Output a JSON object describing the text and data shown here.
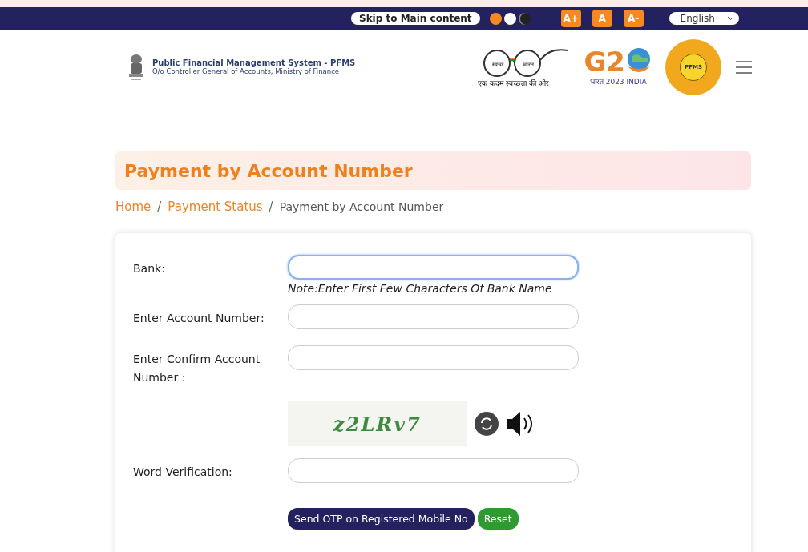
{
  "topbar": {
    "skip_link": "Skip to Main content",
    "themes": [
      {
        "color": "#f7891f",
        "selected": false
      },
      {
        "color": "#ffffff",
        "selected": false
      },
      {
        "color": "#222222",
        "selected": true
      }
    ],
    "font_buttons": [
      "A+",
      "A",
      "A-"
    ],
    "language": "English"
  },
  "header": {
    "org_name": "Public Financial Management System - PFMS",
    "org_sub": "O/o Controller General of Accounts, Ministry of Finance",
    "swachh_left": "स्वच्छ",
    "swachh_right": "भारत",
    "swachh_tagline": "एक कदम स्वच्छता की ओर",
    "g20_text": "G2",
    "g20_sub": "भारत 2023 INDIA",
    "seal_text": "PFMS"
  },
  "page_title": "Payment by Account Number",
  "breadcrumb_separator": "/",
  "breadcrumb": [
    {
      "label": "Home",
      "link": true
    },
    {
      "label": "Payment Status",
      "link": true
    },
    {
      "label": "Payment by Account Number",
      "link": false
    }
  ],
  "form": {
    "fields": [
      {
        "label": "Bank:",
        "focused": true,
        "note": "Note:Enter First Few Characters Of Bank Name"
      },
      {
        "label": "Enter Account Number:",
        "focused": false
      },
      {
        "label": "Enter Confirm Account Number :",
        "focused": false
      }
    ],
    "captcha": "z2LRv7",
    "verification_label": "Word Verification:",
    "buttons": [
      {
        "label": "Send OTP on Registered Mobile No",
        "kind": "primary"
      },
      {
        "label": "Reset",
        "kind": "success"
      }
    ]
  }
}
